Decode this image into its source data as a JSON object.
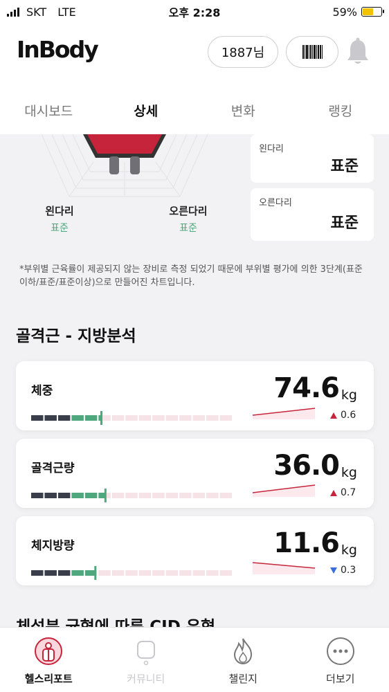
{
  "status_bar": {
    "carrier": "SKT",
    "network": "LTE",
    "time": "오후 2:28",
    "battery": "59%",
    "battery_level": 0.59
  },
  "header": {
    "logo": "InBody",
    "user_label": "1887님",
    "barcode_icon": "barcode-icon",
    "bell_icon": "bell-icon"
  },
  "tabs": [
    {
      "label": "대시보드",
      "active": false
    },
    {
      "label": "상세",
      "active": true
    },
    {
      "label": "변화",
      "active": false
    },
    {
      "label": "랭킹",
      "active": false
    }
  ],
  "segmental": {
    "left_leg_label": "왼다리",
    "left_leg_value": "표준",
    "right_leg_label": "오른다리",
    "right_leg_value": "표준",
    "cards": [
      {
        "label": "왼다리",
        "value": "표준"
      },
      {
        "label": "오른다리",
        "value": "표준"
      }
    ],
    "note": "*부위별 근육률이 제공되지 않는 장비로 측정 되었기 때문에 부위별 평가에 의한 3단계(표준이하/표준/표준이상)으로 만들어진 차트입니다."
  },
  "analysis": {
    "title": "골격근 - 지방분석",
    "items": [
      {
        "label": "체중",
        "value": "74.6",
        "unit": "kg",
        "delta": "0.6",
        "direction": "up",
        "level": 0.35
      },
      {
        "label": "골격근량",
        "value": "36.0",
        "unit": "kg",
        "delta": "0.7",
        "direction": "up",
        "level": 0.37
      },
      {
        "label": "체지방량",
        "value": "11.6",
        "unit": "kg",
        "delta": "0.3",
        "direction": "down",
        "level": 0.32
      }
    ]
  },
  "next_section_title": "체성분 균형에 따른 CID 유형",
  "bottom_nav": [
    {
      "label": "헬스리포트",
      "icon": "health-report-icon",
      "active": true
    },
    {
      "label": "커뮤니티",
      "icon": "community-icon",
      "active": false
    },
    {
      "label": "챌린지",
      "icon": "challenge-flame-icon",
      "active": false
    },
    {
      "label": "더보기",
      "icon": "more-icon",
      "active": false
    }
  ],
  "colors": {
    "accent": "#c5243a",
    "standard_green": "#4fa77d",
    "bar_dark": "#3a3d4a",
    "bar_empty": "#f6e3e8",
    "down": "#3a6fd8"
  }
}
